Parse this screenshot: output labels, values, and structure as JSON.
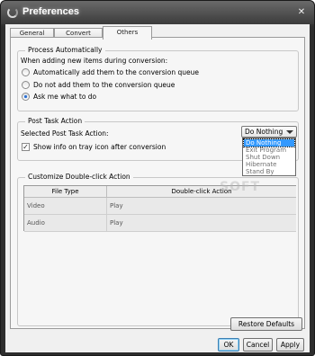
{
  "window": {
    "title": "Preferences",
    "close_glyph": "✕"
  },
  "tabs": [
    {
      "label": "General"
    },
    {
      "label": "Convert"
    },
    {
      "label": "Others",
      "active": true
    }
  ],
  "process": {
    "legend": "Process Automatically",
    "prompt": "When adding new items during conversion:",
    "options": [
      {
        "label": "Automatically add them to the conversion queue",
        "checked": false
      },
      {
        "label": "Do not add them to the conversion queue",
        "checked": false
      },
      {
        "label": "Ask me what to do",
        "checked": true
      }
    ]
  },
  "post_task": {
    "legend": "Post Task Action",
    "selected_label": "Selected Post Task Action:",
    "selected_value": "Do Nothing",
    "options": [
      "Do Nothing",
      "Exit Program",
      "Shut Down",
      "Hibernate",
      "Stand By"
    ],
    "tray_label": "Show info on tray icon after conversion",
    "tray_checked": true
  },
  "double_click": {
    "legend": "Customize Double-click Action",
    "columns": [
      "File Type",
      "Double-click Action"
    ],
    "rows": [
      {
        "type": "Video",
        "action": "Play"
      },
      {
        "type": "Audio",
        "action": "Play"
      }
    ]
  },
  "buttons": {
    "restore": "Restore Defaults",
    "ok": "OK",
    "cancel": "Cancel",
    "apply": "Apply"
  },
  "watermark": "SOFT"
}
